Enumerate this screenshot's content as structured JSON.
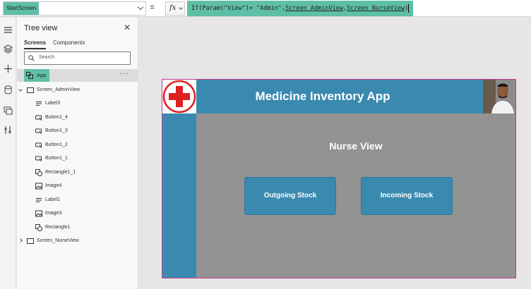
{
  "formula_bar": {
    "property": "StartScreen",
    "equals": "=",
    "fx": "fx",
    "formula_parts": {
      "p1": "If(Param(\"View\")= \"Admin\",",
      "p2": "Screen_AdminView",
      "p3": ",",
      "p4": "Screen_NurseView",
      "p5": ")"
    }
  },
  "tree": {
    "title": "Tree view",
    "tabs": {
      "screens": "Screens",
      "components": "Components"
    },
    "search_placeholder": "Search",
    "app": "App",
    "nodes": [
      {
        "label": "Screen_AdminView",
        "icon": "screen-icon"
      },
      {
        "label": "Label3",
        "icon": "label-icon"
      },
      {
        "label": "Button1_4",
        "icon": "button-icon"
      },
      {
        "label": "Button1_3",
        "icon": "button-icon"
      },
      {
        "label": "Button1_2",
        "icon": "button-icon"
      },
      {
        "label": "Button1_1",
        "icon": "button-icon"
      },
      {
        "label": "Rectangle1_1",
        "icon": "shape-icon"
      },
      {
        "label": "Image4",
        "icon": "image-icon"
      },
      {
        "label": "Label1",
        "icon": "label-icon"
      },
      {
        "label": "Image3",
        "icon": "image-icon"
      },
      {
        "label": "Rectangle1",
        "icon": "shape-icon"
      },
      {
        "label": "Screen_NurseView",
        "icon": "screen-icon"
      }
    ]
  },
  "app_preview": {
    "title": "Medicine Inventory App",
    "view_title": "Nurse View",
    "buttons": {
      "outgoing": "Outgoing Stock",
      "incoming": "Incoming Stock"
    },
    "colors": {
      "header": "#3a8ab0",
      "body": "#939393",
      "border": "#c23b8f",
      "logo_cross": "#e02020"
    }
  },
  "colors": {
    "accent": "#5fbfa6"
  }
}
